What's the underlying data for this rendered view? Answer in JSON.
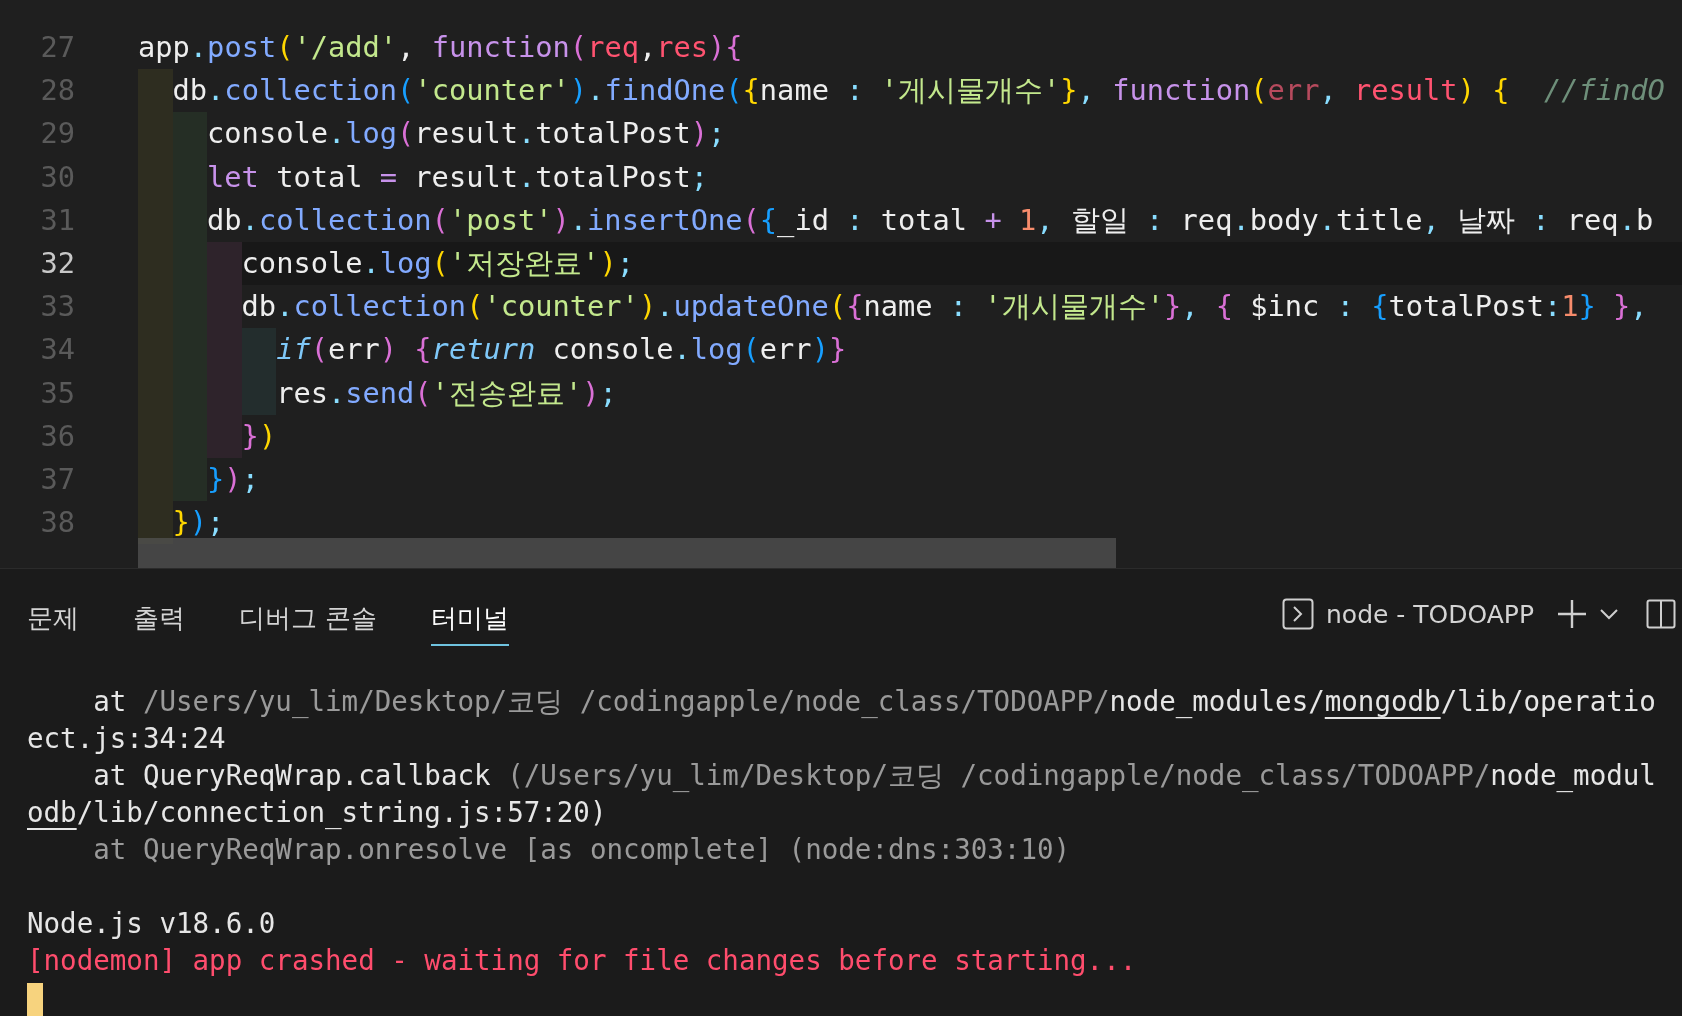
{
  "editor": {
    "lines": [
      {
        "number": "27",
        "current": false,
        "tokens": [
          {
            "kind": "plain",
            "text": "app"
          },
          {
            "kind": "dot",
            "text": "."
          },
          {
            "kind": "fn",
            "text": "post"
          },
          {
            "kind": "br1",
            "text": "("
          },
          {
            "kind": "str",
            "text": "'/add'"
          },
          {
            "kind": "plain",
            "text": ", "
          },
          {
            "kind": "kw",
            "text": "function"
          },
          {
            "kind": "br2",
            "text": "("
          },
          {
            "kind": "param",
            "text": "req"
          },
          {
            "kind": "plain",
            "text": ","
          },
          {
            "kind": "param",
            "text": "res"
          },
          {
            "kind": "br2",
            "text": "){"
          }
        ]
      },
      {
        "number": "28",
        "current": false,
        "tokens": [
          {
            "kind": "plain",
            "text": "  db"
          },
          {
            "kind": "dot",
            "text": "."
          },
          {
            "kind": "fn",
            "text": "collection"
          },
          {
            "kind": "br3",
            "text": "("
          },
          {
            "kind": "str",
            "text": "'counter'"
          },
          {
            "kind": "br3",
            "text": ")"
          },
          {
            "kind": "dot",
            "text": "."
          },
          {
            "kind": "fn",
            "text": "findOne"
          },
          {
            "kind": "br3",
            "text": "("
          },
          {
            "kind": "br1",
            "text": "{"
          },
          {
            "kind": "plain",
            "text": "name "
          },
          {
            "kind": "dot",
            "text": ":"
          },
          {
            "kind": "str",
            "text": " '게시물개수'"
          },
          {
            "kind": "br1",
            "text": "}"
          },
          {
            "kind": "dot",
            "text": ","
          },
          {
            "kind": "kw",
            "text": " function"
          },
          {
            "kind": "br1",
            "text": "("
          },
          {
            "kind": "param_dim",
            "text": "err"
          },
          {
            "kind": "dot",
            "text": ","
          },
          {
            "kind": "param",
            "text": " result"
          },
          {
            "kind": "br1",
            "text": ")"
          },
          {
            "kind": "br1",
            "text": " {"
          },
          {
            "kind": "comment",
            "text": "  //findO"
          }
        ]
      },
      {
        "number": "29",
        "current": false,
        "tokens": [
          {
            "kind": "plain",
            "text": "    console"
          },
          {
            "kind": "dot",
            "text": "."
          },
          {
            "kind": "fn",
            "text": "log"
          },
          {
            "kind": "br2",
            "text": "("
          },
          {
            "kind": "plain",
            "text": "result"
          },
          {
            "kind": "dot",
            "text": "."
          },
          {
            "kind": "plain",
            "text": "totalPost"
          },
          {
            "kind": "br2",
            "text": ")"
          },
          {
            "kind": "dot",
            "text": ";"
          }
        ]
      },
      {
        "number": "30",
        "current": false,
        "tokens": [
          {
            "kind": "kw",
            "text": "    let"
          },
          {
            "kind": "plain",
            "text": " total "
          },
          {
            "kind": "kw",
            "text": "="
          },
          {
            "kind": "plain",
            "text": " result"
          },
          {
            "kind": "dot",
            "text": "."
          },
          {
            "kind": "plain",
            "text": "totalPost"
          },
          {
            "kind": "dot",
            "text": ";"
          }
        ]
      },
      {
        "number": "31",
        "current": false,
        "tokens": [
          {
            "kind": "plain",
            "text": "    db"
          },
          {
            "kind": "dot",
            "text": "."
          },
          {
            "kind": "fn",
            "text": "collection"
          },
          {
            "kind": "br2",
            "text": "("
          },
          {
            "kind": "str",
            "text": "'post'"
          },
          {
            "kind": "br2",
            "text": ")"
          },
          {
            "kind": "dot",
            "text": "."
          },
          {
            "kind": "fn",
            "text": "insertOne"
          },
          {
            "kind": "br2",
            "text": "("
          },
          {
            "kind": "br3",
            "text": "{"
          },
          {
            "kind": "plain",
            "text": "_id "
          },
          {
            "kind": "dot",
            "text": ":"
          },
          {
            "kind": "plain",
            "text": " total "
          },
          {
            "kind": "kw",
            "text": "+"
          },
          {
            "kind": "num",
            "text": " 1"
          },
          {
            "kind": "dot",
            "text": ","
          },
          {
            "kind": "plain",
            "text": " 할일 "
          },
          {
            "kind": "dot",
            "text": ":"
          },
          {
            "kind": "plain",
            "text": " req"
          },
          {
            "kind": "dot",
            "text": "."
          },
          {
            "kind": "plain",
            "text": "body"
          },
          {
            "kind": "dot",
            "text": "."
          },
          {
            "kind": "plain",
            "text": "title"
          },
          {
            "kind": "dot",
            "text": ","
          },
          {
            "kind": "plain",
            "text": " 날짜 "
          },
          {
            "kind": "dot",
            "text": ":"
          },
          {
            "kind": "plain",
            "text": " req"
          },
          {
            "kind": "dot",
            "text": "."
          },
          {
            "kind": "plain",
            "text": "b"
          }
        ]
      },
      {
        "number": "32",
        "current": true,
        "tokens": [
          {
            "kind": "plain",
            "text": "      console"
          },
          {
            "kind": "dot",
            "text": "."
          },
          {
            "kind": "fn",
            "text": "log"
          },
          {
            "kind": "br1",
            "text": "("
          },
          {
            "kind": "str",
            "text": "'저장완료'"
          },
          {
            "kind": "br1",
            "text": ")"
          },
          {
            "kind": "dot",
            "text": ";"
          }
        ]
      },
      {
        "number": "33",
        "current": false,
        "tokens": [
          {
            "kind": "plain",
            "text": "      db"
          },
          {
            "kind": "dot",
            "text": "."
          },
          {
            "kind": "fn",
            "text": "collection"
          },
          {
            "kind": "br1",
            "text": "("
          },
          {
            "kind": "str",
            "text": "'counter'"
          },
          {
            "kind": "br1",
            "text": ")"
          },
          {
            "kind": "dot",
            "text": "."
          },
          {
            "kind": "fn",
            "text": "updateOne"
          },
          {
            "kind": "br1",
            "text": "("
          },
          {
            "kind": "br2",
            "text": "{"
          },
          {
            "kind": "plain",
            "text": "name "
          },
          {
            "kind": "dot",
            "text": ":"
          },
          {
            "kind": "str",
            "text": " '개시물개수'"
          },
          {
            "kind": "br2",
            "text": "}"
          },
          {
            "kind": "dot",
            "text": ","
          },
          {
            "kind": "br2",
            "text": " {"
          },
          {
            "kind": "plain",
            "text": " $inc "
          },
          {
            "kind": "dot",
            "text": ":"
          },
          {
            "kind": "br3",
            "text": " {"
          },
          {
            "kind": "plain",
            "text": "totalPost"
          },
          {
            "kind": "dot",
            "text": ":"
          },
          {
            "kind": "num",
            "text": "1"
          },
          {
            "kind": "br3",
            "text": "}"
          },
          {
            "kind": "br2",
            "text": " }"
          },
          {
            "kind": "dot",
            "text": ","
          }
        ]
      },
      {
        "number": "34",
        "current": false,
        "tokens": [
          {
            "kind": "ctrl",
            "text": "        if"
          },
          {
            "kind": "br2",
            "text": "("
          },
          {
            "kind": "plain",
            "text": "err"
          },
          {
            "kind": "br2",
            "text": ")"
          },
          {
            "kind": "br2",
            "text": " {"
          },
          {
            "kind": "ctrl",
            "text": "return"
          },
          {
            "kind": "plain",
            "text": " console"
          },
          {
            "kind": "dot",
            "text": "."
          },
          {
            "kind": "fn",
            "text": "log"
          },
          {
            "kind": "br3",
            "text": "("
          },
          {
            "kind": "plain",
            "text": "err"
          },
          {
            "kind": "br3",
            "text": ")"
          },
          {
            "kind": "br2",
            "text": "}"
          }
        ]
      },
      {
        "number": "35",
        "current": false,
        "tokens": [
          {
            "kind": "plain",
            "text": "        res"
          },
          {
            "kind": "dot",
            "text": "."
          },
          {
            "kind": "fn",
            "text": "send"
          },
          {
            "kind": "br2",
            "text": "("
          },
          {
            "kind": "str",
            "text": "'전송완료'"
          },
          {
            "kind": "br2",
            "text": ")"
          },
          {
            "kind": "dot",
            "text": ";"
          }
        ]
      },
      {
        "number": "36",
        "current": false,
        "tokens": [
          {
            "kind": "br2",
            "text": "      }"
          },
          {
            "kind": "br1",
            "text": ")"
          }
        ]
      },
      {
        "number": "37",
        "current": false,
        "tokens": [
          {
            "kind": "br3",
            "text": "    }"
          },
          {
            "kind": "br2",
            "text": ")"
          },
          {
            "kind": "dot",
            "text": ";"
          }
        ]
      },
      {
        "number": "38",
        "current": false,
        "tokens": [
          {
            "kind": "br1",
            "text": "  }"
          },
          {
            "kind": "br3",
            "text": ")"
          },
          {
            "kind": "dot",
            "text": ";"
          }
        ]
      }
    ]
  },
  "panel": {
    "tabs": [
      {
        "label": "문제",
        "selected": false
      },
      {
        "label": "출력",
        "selected": false
      },
      {
        "label": "디버그 콘솔",
        "selected": false
      },
      {
        "label": "터미널",
        "selected": true
      }
    ],
    "terminal_name": "node - TODOAPP",
    "terminal_lines": [
      {
        "kind": "output",
        "segments": [
          {
            "kind": "bright",
            "text": "    at "
          },
          {
            "kind": "dim",
            "text": "/Users/yu_lim/Desktop/코딩 /codingapple/node_class/TODOAPP/"
          },
          {
            "kind": "bright",
            "text": "node_modules/"
          },
          {
            "kind": "link",
            "text": "mongodb"
          },
          {
            "kind": "bright",
            "text": "/lib/operatio"
          }
        ]
      },
      {
        "kind": "output",
        "segments": [
          {
            "kind": "bright",
            "text": "ect.js:34:24"
          }
        ]
      },
      {
        "kind": "output",
        "segments": [
          {
            "kind": "bright",
            "text": "    at QueryReqWrap.callback "
          },
          {
            "kind": "dim",
            "text": "(/Users/yu_lim/Desktop/코딩 /codingapple/node_class/TODOAPP/"
          },
          {
            "kind": "bright",
            "text": "node_modul"
          }
        ]
      },
      {
        "kind": "output",
        "segments": [
          {
            "kind": "link",
            "text": "odb"
          },
          {
            "kind": "bright",
            "text": "/lib/connection_string.js:57:20)"
          }
        ]
      },
      {
        "kind": "output",
        "segments": [
          {
            "kind": "dim",
            "text": "    at QueryReqWrap.onresolve [as oncomplete] (node:dns:303:10)"
          }
        ]
      },
      {
        "kind": "blank"
      },
      {
        "kind": "output",
        "segments": [
          {
            "kind": "bright",
            "text": "Node.js v18.6.0"
          }
        ]
      },
      {
        "kind": "output",
        "segments": [
          {
            "kind": "error",
            "text": "[nodemon] app crashed - waiting for file changes before starting..."
          }
        ]
      },
      {
        "kind": "cursor"
      }
    ]
  }
}
